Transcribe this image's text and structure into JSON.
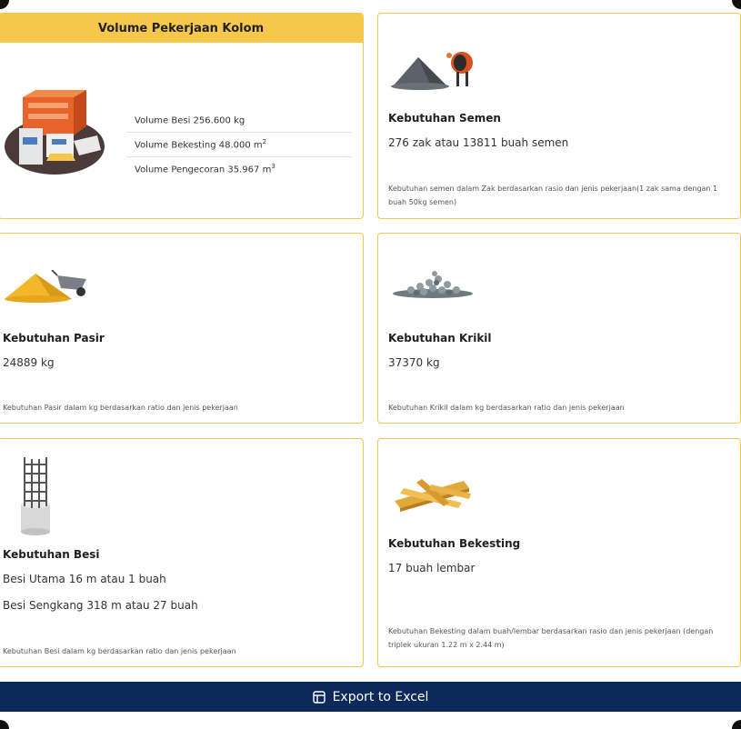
{
  "volume": {
    "title": "Volume Pekerjaan Kolom",
    "items": [
      {
        "label": "Volume Besi 256.600 kg",
        "unit_sup": ""
      },
      {
        "label": "Volume Bekesting 48.000 m",
        "unit_sup": "2"
      },
      {
        "label": "Volume Pengecoran 35.967 m",
        "unit_sup": "3"
      }
    ]
  },
  "semen": {
    "title": "Kebutuhan Semen",
    "value": "276 zak atau 13811 buah semen",
    "note": "Kebutuhan semen dalam Zak berdasarkan rasio dan jenis pekerjaan(1 zak sama dengan 1 buah 50kg semen)"
  },
  "pasir": {
    "title": "Kebutuhan Pasir",
    "value": "24889 kg",
    "note": "Kebutuhan Pasir dalam kg berdasarkan ratio dan jenis pekerjaan"
  },
  "krikil": {
    "title": "Kebutuhan Krikil",
    "value": "37370 kg",
    "note": "Kebutuhan Krikil dalam kg berdasarkan ratio dan jenis pekerjaan"
  },
  "besi": {
    "title": "Kebutuhan Besi",
    "value_main": "Besi Utama 16 m atau 1 buah",
    "value_sengkang": "Besi Sengkang 318 m atau 27 buah",
    "note": "Kebutuhan Besi dalam kg berdasarkan ratio dan jenis pekerjaan"
  },
  "bekesting": {
    "title": "Kebutuhan Bekesting",
    "value": "17 buah lembar",
    "note": "Kebutuhan Bekesting dalam buah/lembar berdasarkan rasio dan jenis pekerjaan (dengan triplek ukuran 1.22 m x 2.44 m)"
  },
  "export": {
    "label": "Export to Excel",
    "icon": "table-icon"
  },
  "colors": {
    "accent": "#f5c84c",
    "border": "#f2c94c",
    "export_bar": "#0b2a5b"
  }
}
